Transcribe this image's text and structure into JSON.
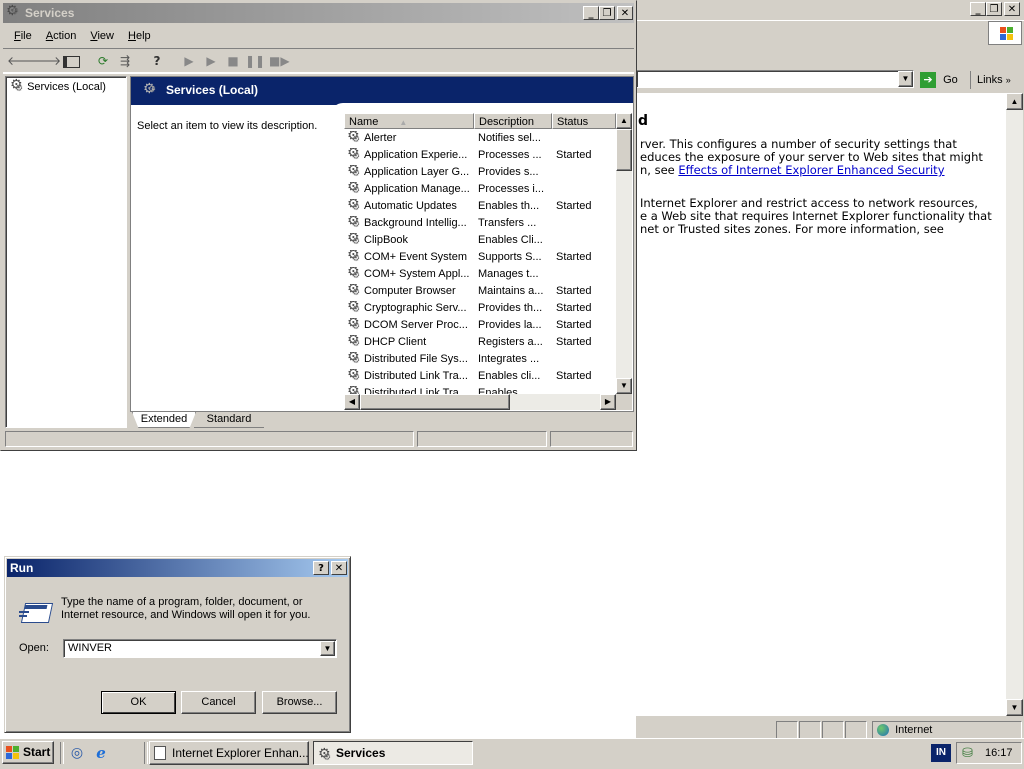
{
  "ie": {
    "go_label": "Go",
    "links_label": "Links",
    "content": {
      "heading_fragment": "d",
      "p1_line1": "rver. This configures a number of security settings that",
      "p1_line2": "educes the exposure of your server to Web sites that might",
      "p1_line3_prefix": "n, see ",
      "p1_link": "Effects of Internet Explorer Enhanced Security",
      "p2_line1": "Internet Explorer and restrict access to network resources,",
      "p2_line2": "e a Web site that requires Internet Explorer functionality that",
      "p2_line3": "net or Trusted sites zones. For more information, see"
    },
    "status_zone": "Internet"
  },
  "services": {
    "title": "Services",
    "menu": [
      {
        "key": "F",
        "rest": "ile"
      },
      {
        "key": "A",
        "rest": "ction"
      },
      {
        "key": "V",
        "rest": "iew"
      },
      {
        "key": "H",
        "rest": "elp"
      }
    ],
    "tree_item": "Services (Local)",
    "pane_header": "Services (Local)",
    "description_hint": "Select an item to view its description.",
    "columns": {
      "name": "Name",
      "description": "Description",
      "status": "Status"
    },
    "rows": [
      {
        "name": "Alerter",
        "description": "Notifies sel...",
        "status": ""
      },
      {
        "name": "Application Experie...",
        "description": "Processes ...",
        "status": "Started"
      },
      {
        "name": "Application Layer G...",
        "description": "Provides s...",
        "status": ""
      },
      {
        "name": "Application Manage...",
        "description": "Processes i...",
        "status": ""
      },
      {
        "name": "Automatic Updates",
        "description": "Enables th...",
        "status": "Started"
      },
      {
        "name": "Background Intellig...",
        "description": "Transfers ...",
        "status": ""
      },
      {
        "name": "ClipBook",
        "description": "Enables Cli...",
        "status": ""
      },
      {
        "name": "COM+ Event System",
        "description": "Supports S...",
        "status": "Started"
      },
      {
        "name": "COM+ System Appl...",
        "description": "Manages t...",
        "status": ""
      },
      {
        "name": "Computer Browser",
        "description": "Maintains a...",
        "status": "Started"
      },
      {
        "name": "Cryptographic Serv...",
        "description": "Provides th...",
        "status": "Started"
      },
      {
        "name": "DCOM Server Proc...",
        "description": "Provides la...",
        "status": "Started"
      },
      {
        "name": "DHCP Client",
        "description": "Registers a...",
        "status": "Started"
      },
      {
        "name": "Distributed File Sys...",
        "description": "Integrates ...",
        "status": ""
      },
      {
        "name": "Distributed Link Tra...",
        "description": "Enables cli...",
        "status": "Started"
      },
      {
        "name": "Distributed Link Tra...",
        "description": "Enables ...",
        "status": ""
      }
    ],
    "tabs": {
      "extended": "Extended",
      "standard": "Standard"
    }
  },
  "run": {
    "title": "Run",
    "description": "Type the name of a program, folder, document, or Internet resource, and Windows will open it for you.",
    "open_label": "Open:",
    "open_value": "WINVER",
    "ok_label": "OK",
    "cancel_label": "Cancel",
    "browse_label": "Browse..."
  },
  "taskbar": {
    "start_label": "Start",
    "tasks": [
      {
        "label": "Internet Explorer Enhan..."
      },
      {
        "label": "Services"
      }
    ],
    "language": "IN",
    "clock": "16:17"
  }
}
